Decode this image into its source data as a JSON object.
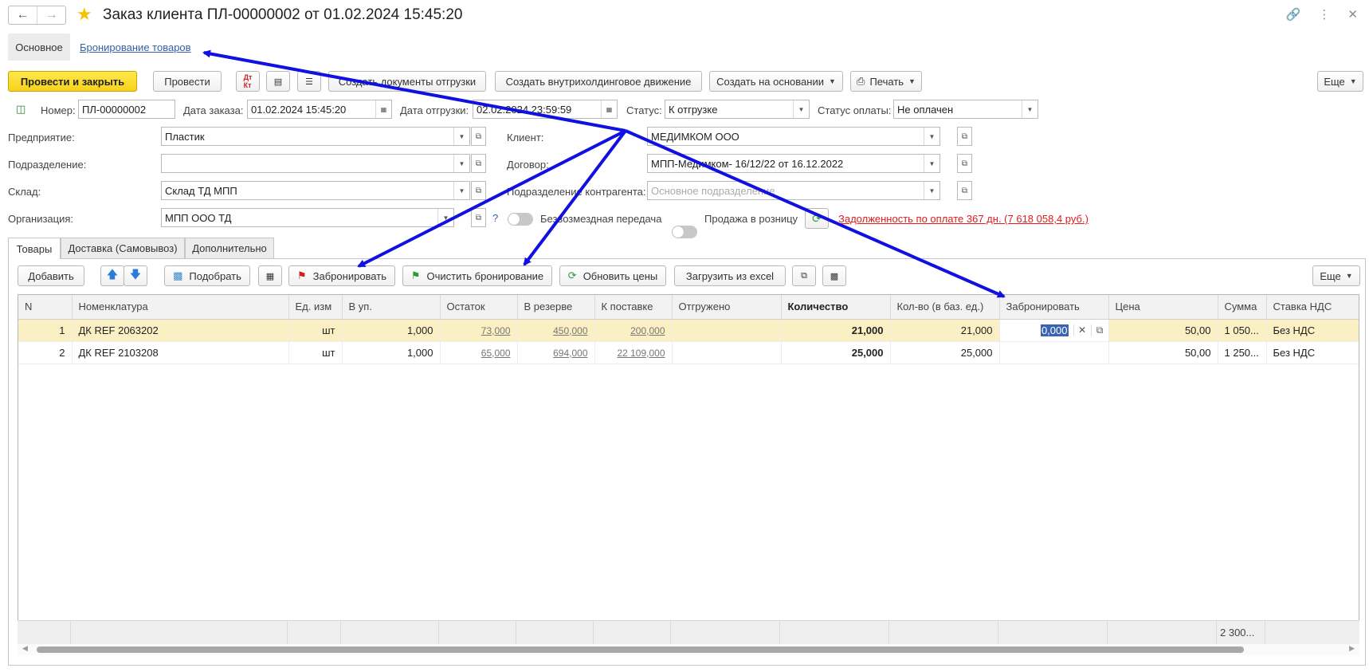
{
  "window": {
    "title": "Заказ клиента ПЛ-00000002 от 01.02.2024 15:45:20"
  },
  "page_tabs": {
    "main": "Основное",
    "booking": "Бронирование товаров"
  },
  "toolbar": {
    "post_close": "Провести и закрыть",
    "post": "Провести",
    "create_shipping": "Создать документы отгрузки",
    "create_internal": "Создать внутрихолдинговое движение",
    "create_based": "Создать на основании",
    "print": "Печать",
    "more": "Еще"
  },
  "header": {
    "number_label": "Номер:",
    "number": "ПЛ-00000002",
    "order_date_label": "Дата заказа:",
    "order_date": "01.02.2024 15:45:20",
    "ship_date_label": "Дата отгрузки:",
    "ship_date": "02.02.2024 23:59:59",
    "status_label": "Статус:",
    "status": "К отгрузке",
    "pay_status_label": "Статус оплаты:",
    "pay_status": "Не оплачен"
  },
  "form": {
    "enterprise_label": "Предприятие:",
    "enterprise": "Пластик",
    "division_label": "Подразделение:",
    "division": "",
    "warehouse_label": "Склад:",
    "warehouse": "Склад ТД МПП",
    "org_label": "Организация:",
    "org": "МПП ООО ТД",
    "client_label": "Клиент:",
    "client": "МЕДИМКОМ ООО",
    "contract_label": "Договор:",
    "contract": "МПП-Медимком- 16/12/22 от 16.12.2022",
    "cp_division_label": "Подразделение контрагента:",
    "cp_division_placeholder": "Основное подразделение",
    "free_transfer": "Безвозмездная передача",
    "retail": "Продажа в розницу",
    "debt": "Задолженность по оплате 367 дн. (7 618 058,4 руб.)",
    "help": "?"
  },
  "inner_tabs": [
    "Товары",
    "Доставка (Самовывоз)",
    "Дополнительно"
  ],
  "grid_toolbar": {
    "add": "Добавить",
    "pick": "Подобрать",
    "book": "Забронировать",
    "clear_booking": "Очистить бронирование",
    "update_prices": "Обновить цены",
    "load_excel": "Загрузить из excel",
    "more": "Еще"
  },
  "table": {
    "columns": [
      "N",
      "Номенклатура",
      "Ед. изм",
      "В уп.",
      "Остаток",
      "В резерве",
      "К поставке",
      "Отгружено",
      "Количество",
      "Кол-во (в баз. ед.)",
      "Забронировать",
      "Цена",
      "Сумма",
      "Ставка НДС"
    ],
    "rows": [
      {
        "n": "1",
        "name": "ДК REF 2063202",
        "unit": "шт",
        "pack": "1,000",
        "stock": "73,000",
        "reserve": "450,000",
        "to_supply": "200,000",
        "shipped": "",
        "qty": "21,000",
        "qty_base": "21,000",
        "book": "0,000",
        "price": "50,00",
        "sum": "1 050...",
        "vat": "Без НДС"
      },
      {
        "n": "2",
        "name": "ДК REF 2103208",
        "unit": "шт",
        "pack": "1,000",
        "stock": "65,000",
        "reserve": "694,000",
        "to_supply": "22 109,000",
        "shipped": "",
        "qty": "25,000",
        "qty_base": "25,000",
        "book": "",
        "price": "50,00",
        "sum": "1 250...",
        "vat": "Без НДС"
      }
    ],
    "total_sum": "2 300..."
  },
  "colors": {
    "accent_yellow": "#f7d21b",
    "link": "#3361aa",
    "error": "#e21b1b",
    "arrow": "#1010e0",
    "selected_row": "#fbf0c4"
  }
}
